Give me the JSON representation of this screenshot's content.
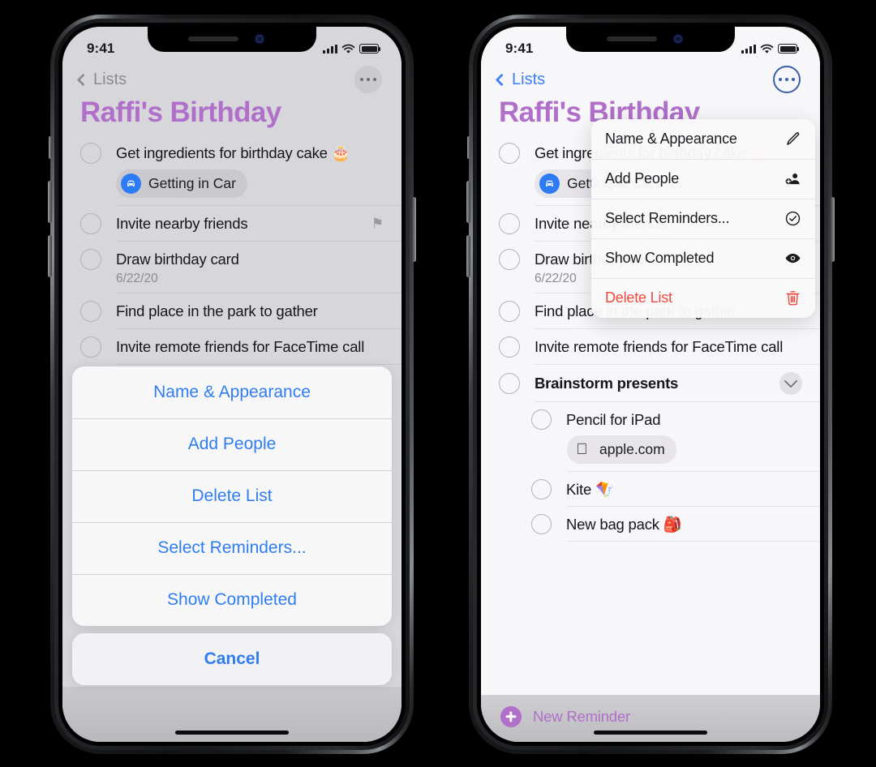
{
  "status_bar": {
    "time": "9:41",
    "signal_icon": "cellular-bars-icon",
    "wifi_icon": "wifi-icon",
    "battery_icon": "battery-full-icon"
  },
  "nav": {
    "back_label": "Lists",
    "more_icon": "ellipsis-icon",
    "back_icon": "chevron-left-icon"
  },
  "list": {
    "title": "Raffi's Birthday",
    "items": [
      {
        "text": "Get ingredients for birthday cake 🎂",
        "chip": "Getting in Car",
        "chip_icon": "car-icon"
      },
      {
        "text": "Invite nearby friends",
        "accessory": "flag-icon"
      },
      {
        "text": "Draw birthday card",
        "sub": "6/22/20"
      },
      {
        "text": "Find place in the park to gather"
      },
      {
        "text": "Invite remote friends for FaceTime call"
      },
      {
        "text": "Brainstorm presents",
        "bold": true,
        "accessory": "chevron-down-icon"
      }
    ],
    "sub_items": [
      {
        "text": "Pencil for iPad",
        "chip": "apple.com",
        "chip_icon": "apple-logo-icon"
      },
      {
        "text": "Kite 🪁"
      },
      {
        "text": "New bag pack 🎒"
      }
    ],
    "new_reminder": {
      "label": "New Reminder",
      "icon": "plus-circle-icon"
    }
  },
  "action_sheet": {
    "items": [
      "Name & Appearance",
      "Add People",
      "Delete List",
      "Select Reminders...",
      "Show Completed"
    ],
    "cancel": "Cancel"
  },
  "context_menu": {
    "items": [
      {
        "label": "Name & Appearance",
        "icon": "pencil-icon",
        "destructive": false
      },
      {
        "label": "Add People",
        "icon": "person-badge-plus-icon",
        "destructive": false
      },
      {
        "label": "Select Reminders...",
        "icon": "checkmark-circle-icon",
        "destructive": false
      },
      {
        "label": "Show Completed",
        "icon": "eye-icon",
        "destructive": false
      },
      {
        "label": "Delete List",
        "icon": "trash-icon",
        "destructive": true
      }
    ]
  },
  "colors": {
    "title_purple": "#b06fc9",
    "action_blue": "#2f7df0",
    "destructive_red": "#ef4a3f",
    "chip_blue": "#2d7cf6",
    "screen_bg": "#d7d7db"
  }
}
